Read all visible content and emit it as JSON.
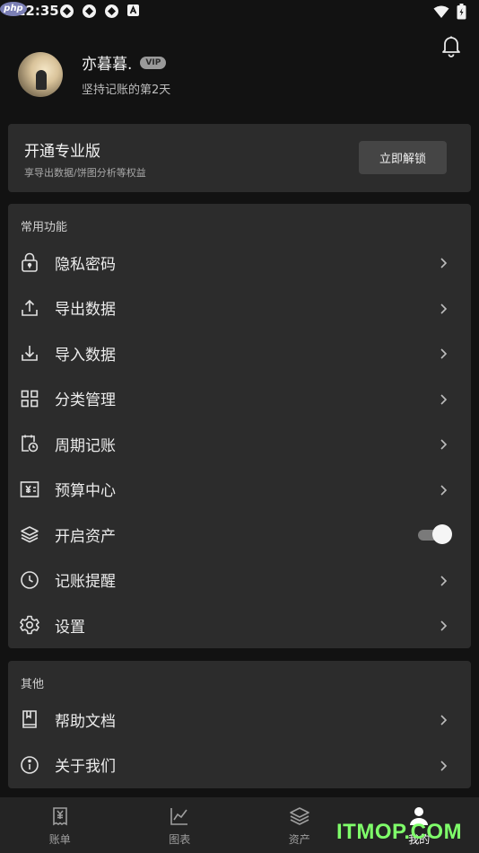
{
  "status_bar": {
    "time": "12:35",
    "php_logo": "php"
  },
  "profile": {
    "username": "亦暮暮.",
    "vip_badge": "VIP",
    "streak": "坚持记账的第2天"
  },
  "pro": {
    "title": "开通专业版",
    "subtitle": "享导出数据/饼图分析等权益",
    "button_label": "立即解锁"
  },
  "common": {
    "title": "常用功能",
    "items": [
      {
        "label": "隐私密码",
        "icon": "lock-icon"
      },
      {
        "label": "导出数据",
        "icon": "export-icon"
      },
      {
        "label": "导入数据",
        "icon": "import-icon"
      },
      {
        "label": "分类管理",
        "icon": "grid-icon"
      },
      {
        "label": "周期记账",
        "icon": "calendar-clock-icon"
      },
      {
        "label": "预算中心",
        "icon": "budget-icon"
      },
      {
        "label": "开启资产",
        "icon": "layers-icon",
        "toggle_on": true
      },
      {
        "label": "记账提醒",
        "icon": "clock-icon"
      },
      {
        "label": "设置",
        "icon": "gear-icon"
      }
    ]
  },
  "other": {
    "title": "其他",
    "items": [
      {
        "label": "帮助文档",
        "icon": "book-icon"
      },
      {
        "label": "关于我们",
        "icon": "info-icon"
      }
    ]
  },
  "tabbar": {
    "tabs": [
      {
        "label": "账单",
        "icon": "bill-icon",
        "active": false
      },
      {
        "label": "图表",
        "icon": "chart-icon",
        "active": false
      },
      {
        "label": "资产",
        "icon": "assets-icon",
        "active": false
      },
      {
        "label": "我的",
        "icon": "user-icon",
        "active": true
      }
    ]
  },
  "watermark": "ITMOP.COM"
}
